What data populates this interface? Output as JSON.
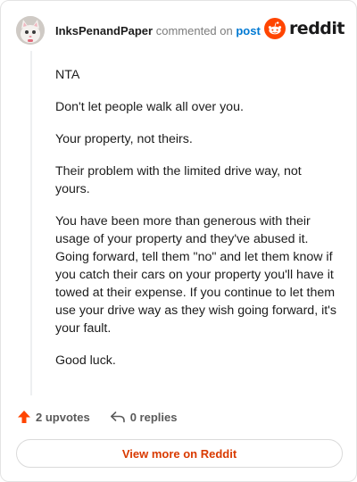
{
  "header": {
    "author": "InksPenandPaper",
    "action": "commented on",
    "post_link": "post",
    "logo_text": "reddit"
  },
  "comment": {
    "paragraphs": [
      "NTA",
      "Don't let people walk all over you.",
      "Your property, not theirs.",
      "Their problem with the limited drive way, not yours.",
      "You have been more than generous with their usage of your property and they've abused it. Going forward, tell them \"no\" and let them know if you catch their cars on your property you'll have it towed at their expense. If you continue to let them use your drive way as they wish going forward, it's your fault.",
      "Good luck."
    ]
  },
  "footer": {
    "upvotes": "2 upvotes",
    "replies": "0 replies"
  },
  "button": {
    "view_label": "View more on Reddit"
  },
  "colors": {
    "brand": "#ff4500",
    "link": "#0079d3",
    "button_text": "#d93a00"
  },
  "icons": {
    "avatar": "cat-avatar",
    "logo": "reddit-snoo-icon",
    "upvote": "upvote-arrow-icon",
    "reply": "reply-arrow-icon"
  }
}
